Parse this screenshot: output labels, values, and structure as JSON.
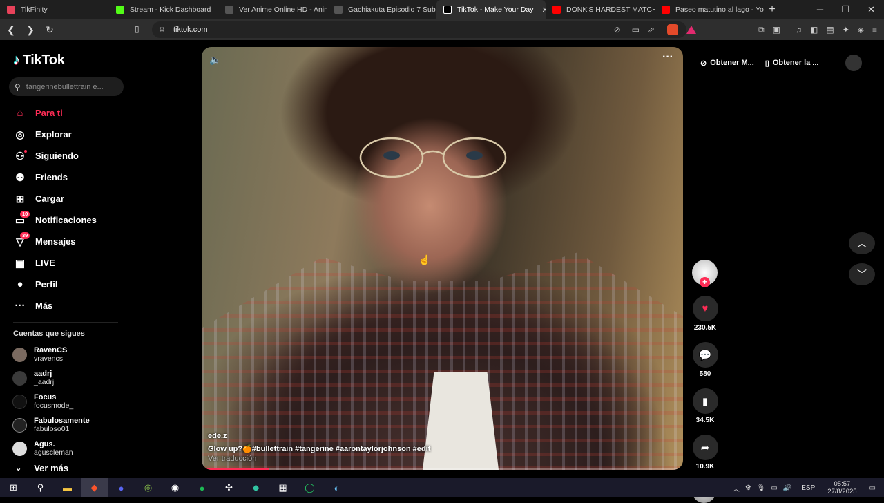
{
  "browser": {
    "tabs": [
      {
        "title": "TikFinity",
        "color": "#e8425a"
      },
      {
        "title": "Stream - Kick Dashboard",
        "color": "#53fc18"
      },
      {
        "title": "Ver Anime Online HD - Anim",
        "color": "#cccccc"
      },
      {
        "title": "Gachiakuta Episodio 7 Sub E",
        "color": "#cccccc"
      },
      {
        "title": "TikTok - Make Your Day",
        "color": "#ffffff"
      },
      {
        "title": "DONK'S HARDEST MATCH E",
        "color": "#ff0000"
      },
      {
        "title": "Paseo matutino al lago - Yo",
        "color": "#ff0000"
      }
    ],
    "active_tab_index": 4,
    "url": "tiktok.com",
    "brave_shield_count": "5"
  },
  "sidebar": {
    "logo": "TikTok",
    "search_placeholder": "tangerinebullettrain e...",
    "menu": [
      {
        "label": "Para ti",
        "icon": "home-icon",
        "active": true
      },
      {
        "label": "Explorar",
        "icon": "compass-icon"
      },
      {
        "label": "Siguiendo",
        "icon": "following-icon"
      },
      {
        "label": "Friends",
        "icon": "friends-icon"
      },
      {
        "label": "Cargar",
        "icon": "upload-icon"
      },
      {
        "label": "Notificaciones",
        "icon": "inbox-icon",
        "badge": "10"
      },
      {
        "label": "Mensajes",
        "icon": "message-icon",
        "badge": "39"
      },
      {
        "label": "LIVE",
        "icon": "live-icon"
      },
      {
        "label": "Perfil",
        "icon": "profile-icon"
      },
      {
        "label": "Más",
        "icon": "more-icon"
      }
    ],
    "following_title": "Cuentas que sigues",
    "following": [
      {
        "name": "RavenCS",
        "handle": "vravencs"
      },
      {
        "name": "aadrj",
        "handle": "_aadrj"
      },
      {
        "name": "Focus",
        "handle": "focusmode_"
      },
      {
        "name": "Fabulosamente",
        "handle": "fabuloso01"
      },
      {
        "name": "Agus.",
        "handle": "aguscleman"
      }
    ],
    "see_more": "Ver más"
  },
  "video": {
    "username": "ede.z",
    "caption": "Glow up?🍊#bullettrain #tangerine #aarontaylorjohnson #edit",
    "translate": "Ver traducción",
    "progress_fraction": 0.14
  },
  "actions": {
    "likes": "230.5K",
    "comments": "580",
    "saves": "34.5K",
    "shares": "10.9K"
  },
  "top_right": {
    "get_coins": "Obtener M...",
    "get_app": "Obtener la ..."
  },
  "taskbar": {
    "lang": "ESP",
    "time": "05:57",
    "date": "27/8/2025"
  }
}
